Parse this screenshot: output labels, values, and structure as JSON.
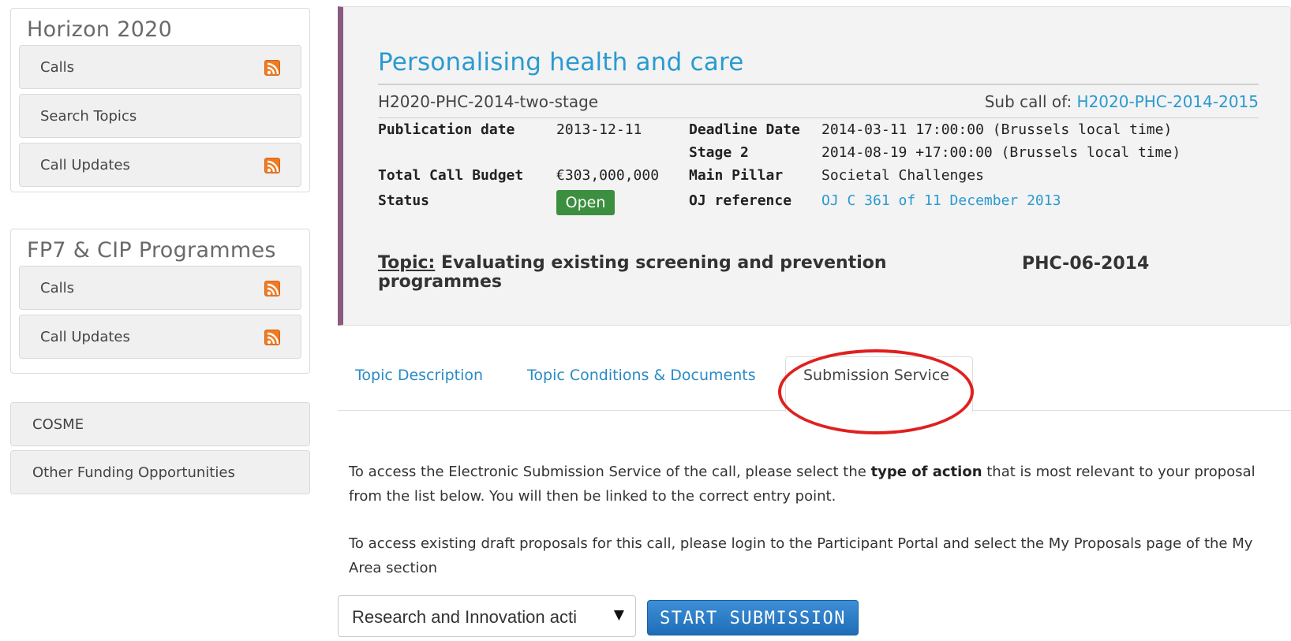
{
  "sidebar": {
    "horizon": {
      "title": "Horizon 2020",
      "items": [
        {
          "label": "Calls",
          "icon": "rss-icon"
        },
        {
          "label": "Search Topics"
        },
        {
          "label": "Call Updates",
          "icon": "rss-icon"
        }
      ]
    },
    "fp7": {
      "title": "FP7 & CIP Programmes",
      "items": [
        {
          "label": "Calls",
          "icon": "rss-icon"
        },
        {
          "label": "Call Updates",
          "icon": "rss-icon"
        }
      ]
    },
    "cosme": "COSME",
    "other": "Other Funding Opportunities"
  },
  "call": {
    "title": "Personalising health and care",
    "id": "H2020-PHC-2014-two-stage",
    "subcall_prefix": "Sub call of: ",
    "subcall_link": "H2020-PHC-2014-2015",
    "publication_label": "Publication date",
    "publication_value": "2013-12-11",
    "budget_label": "Total Call Budget",
    "budget_value": "€303,000,000",
    "status_label": "Status",
    "status_value": "Open",
    "deadline_label": "Deadline Date",
    "deadline_value": "2014-03-11 17:00:00 (Brussels local time)",
    "stage2_label": "Stage 2",
    "stage2_value": "2014-08-19 +17:00:00 (Brussels local time)",
    "pillar_label": "Main Pillar",
    "pillar_value": "Societal Challenges",
    "oj_label": "OJ reference",
    "oj_value": "OJ C 361 of 11 December 2013",
    "topic_label": "Topic:",
    "topic_value": " Evaluating existing screening and prevention programmes",
    "topic_code": "PHC-06-2014"
  },
  "tabs": [
    {
      "label": "Topic Description"
    },
    {
      "label": "Topic Conditions & Documents"
    },
    {
      "label": "Submission Service",
      "active": true
    }
  ],
  "content": {
    "para1_a": "To access the Electronic Submission Service of the call, please select the ",
    "para1_bold": "type of action",
    "para1_b": " that is most relevant to your proposal from the list below. You will then be linked to the correct entry point.",
    "para2": "To access existing draft proposals for this call, please login to the Participant Portal and select the My Proposals page of the My Area section"
  },
  "form": {
    "select_value": "Research and Innovation acti",
    "button_label": "START SUBMISSION"
  },
  "colors": {
    "accent_blue": "#2a9ad0",
    "status_green": "#3c8f3f",
    "card_border": "#8a5a80",
    "highlight_red": "#e02020",
    "rss_orange": "#f07b22"
  }
}
